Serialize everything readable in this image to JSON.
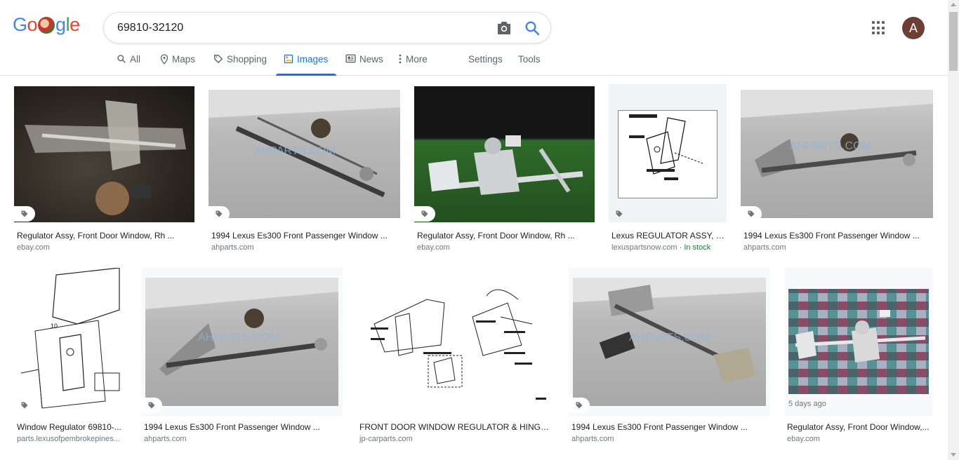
{
  "search": {
    "query": "69810-32120"
  },
  "account": {
    "initial": "A"
  },
  "colors": {
    "accent": "#1a73e8",
    "avatar_bg": "#6d3f34",
    "in_stock": "#188038"
  },
  "tabs": [
    {
      "label": "All",
      "icon": "search-icon",
      "active": false
    },
    {
      "label": "Maps",
      "icon": "map-pin-icon",
      "active": false
    },
    {
      "label": "Shopping",
      "icon": "tag-icon",
      "active": false
    },
    {
      "label": "Images",
      "icon": "image-icon",
      "active": true
    },
    {
      "label": "News",
      "icon": "news-icon",
      "active": false
    },
    {
      "label": "More",
      "icon": "more-vert-icon",
      "active": false
    },
    {
      "label": "Settings",
      "active": false
    },
    {
      "label": "Tools",
      "active": false
    }
  ],
  "results": [
    {
      "caption": "Regulator Assy, Front Door Window, Rh ...",
      "source": "ebay.com",
      "shopping_tag": true
    },
    {
      "caption": "1994 Lexus Es300 Front Passenger Window ...",
      "source": "ahparts.com",
      "shopping_tag": true,
      "watermark": "AHPARTS.COM"
    },
    {
      "caption": "Regulator Assy, Front Door Window, Rh ...",
      "source": "ebay.com",
      "shopping_tag": true
    },
    {
      "caption": "Lexus REGULATOR ASSY, F...",
      "source": "lexuspartsnow.com",
      "source_extra": " · In stock",
      "shopping_tag": true
    },
    {
      "caption": "1994 Lexus Es300 Front Passenger Window ...",
      "source": "ahparts.com",
      "shopping_tag": true,
      "watermark": "AHPARTS.COM"
    },
    {
      "caption": "Window Regulator 69810-...",
      "source": "parts.lexusofpembrokepines...",
      "shopping_tag": true
    },
    {
      "caption": "1994 Lexus Es300 Front Passenger Window ...",
      "source": "ahparts.com",
      "shopping_tag": true,
      "watermark": "AHPARTS.COM"
    },
    {
      "caption": "FRONT DOOR WINDOW REGULATOR & HINGE ...",
      "source": "jp-carparts.com",
      "shopping_tag": false
    },
    {
      "caption": "1994 Lexus Es300 Front Passenger Window ...",
      "source": "ahparts.com",
      "shopping_tag": true,
      "watermark": "AHPARTS.COM"
    },
    {
      "caption": "Regulator Assy, Front Door Window,...",
      "source": "ebay.com",
      "time_ago": "5 days ago",
      "shopping_tag": false
    }
  ]
}
